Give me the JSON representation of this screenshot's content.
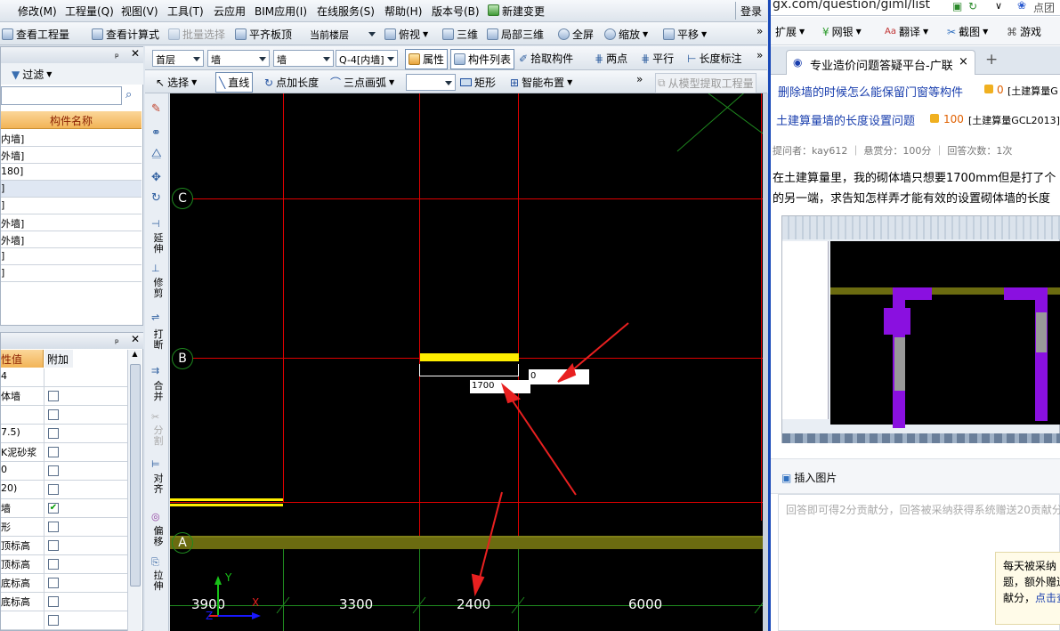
{
  "menu": {
    "items": [
      "修改(M)",
      "工程量(Q)",
      "视图(V)",
      "工具(T)",
      "云应用",
      "BIM应用(I)",
      "在线服务(S)",
      "帮助(H)",
      "版本号(B)",
      "新建变更"
    ],
    "login": "登录"
  },
  "toolbar1": {
    "view_project": "查看工程量",
    "view_formula": "查看计算式",
    "batch_select": "批量选择",
    "flat_slab": "平齐板顶",
    "floor_select": "当前楼层",
    "top_view": "俯视",
    "three_d": "三维",
    "local_3d": "局部三维",
    "fullscreen": "全屏",
    "zoom": "缩放",
    "pan": "平移"
  },
  "left_panel": {
    "pin": "中",
    "filter": "过滤",
    "column_header": "构件名称",
    "items": [
      "内墙]",
      "外墙]",
      "180]",
      "]",
      "]",
      "外墙]",
      "外墙]",
      "]",
      "]"
    ]
  },
  "props_panel": {
    "col_value": "性值",
    "col_extra": "附加",
    "rows": [
      {
        "v": "4",
        "c": null
      },
      {
        "v": "体墙",
        "c": false
      },
      {
        "v": "",
        "c": false
      },
      {
        "v": "7.5)",
        "c": false
      },
      {
        "v": "K泥砂浆",
        "c": false
      },
      {
        "v": "0",
        "c": false
      },
      {
        "v": "20)",
        "c": false
      },
      {
        "v": "墙",
        "c": true
      },
      {
        "v": "形",
        "c": false
      },
      {
        "v": "顶标高",
        "c": false
      },
      {
        "v": "顶标高",
        "c": false
      },
      {
        "v": "底标高",
        "c": false
      },
      {
        "v": "底标高",
        "c": false
      },
      {
        "v": "",
        "c": false
      }
    ]
  },
  "toolbar2": {
    "floor": "首层",
    "type1": "墙",
    "type2": "墙",
    "component": "Q-4[内墙]",
    "attributes": "属性",
    "component_list": "构件列表",
    "pick_component": "拾取构件",
    "two_point": "两点",
    "parallel": "平行",
    "length_dim": "长度标注"
  },
  "toolbar3": {
    "select": "选择",
    "line": "直线",
    "point_length": "点加长度",
    "three_point_arc": "三点画弧",
    "rect": "矩形",
    "smart_layout": "智能布置",
    "extract_model": "从模型提取工程量"
  },
  "side_tools": [
    "延伸",
    "修剪",
    "打断",
    "合并",
    "分割",
    "对齐",
    "偏移",
    "拉伸"
  ],
  "canvas": {
    "axis_labels": [
      "C",
      "B",
      "A"
    ],
    "dims": [
      "3900",
      "3300",
      "2400",
      "6000"
    ],
    "input_length": "1700",
    "input_angle": "0",
    "ucs": {
      "x": "X",
      "y": "Y",
      "z": "Z"
    }
  },
  "browser": {
    "url": "gx.com/question/giml/list",
    "top_right": "点团",
    "bm_items": [
      "扩展",
      "网银",
      "翻译",
      "截图",
      "游戏"
    ],
    "tab_title": "专业造价问题答疑平台-广联达",
    "tab_close": "×",
    "new_tab": "+",
    "q1_title": "删除墙的时候怎么能保留门窗等构件",
    "q1_coins": "0",
    "q1_tag": "[土建算量G",
    "q2_title": "土建算量墙的长度设置问题",
    "q2_coins": "100",
    "q2_tag": "[土建算量GCL2013]",
    "meta": "提问者：kay612 ｜ 悬赏分：100分 ｜ 回答次数：1次",
    "body_l1": "在土建算量里，我的砌体墙只想要1700mm但是打了个",
    "body_l2": "的另一端，求告知怎样弄才能有效的设置砌体墙的长度",
    "insert_image": "插入图片",
    "answer_placeholder": "回答即可得2分贡献分，回答被采纳获得系统赠送20贡献分",
    "tip1": "每天被采纳",
    "tip2": "题，额外赠送",
    "tip3": "献分，",
    "tip_link": "点击查"
  },
  "colors": {
    "canvas_bg": "#000000",
    "grid_red": "#e00000",
    "grid_green": "#1f8a1f",
    "wall_yellow": "#ffee00",
    "wall_olive": "#6b6b10",
    "arrow_red": "#e82020",
    "link_blue": "#1a3fae"
  }
}
